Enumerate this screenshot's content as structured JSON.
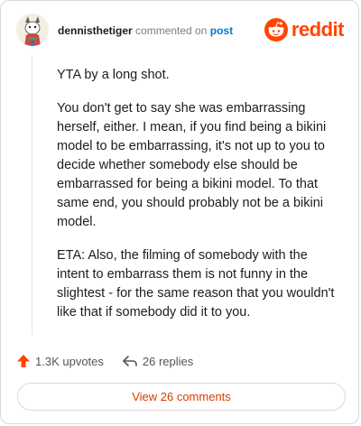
{
  "comment": {
    "username": "dennisthetiger",
    "action_text": "commented on",
    "post_link": "post",
    "paragraphs": [
      "YTA by a long shot.",
      "You don't get to say she was embarrassing herself, either. I mean, if you find being a bikini model to be embarrassing, it's not up to you to decide whether somebody else should be embarrassed for being a bikini model. To that same end, you should probably not be a bikini model.",
      "ETA: Also, the filming of somebody with the intent to embarrass them is not funny in the slightest - for the same reason that you wouldn't like that if somebody did it to you."
    ]
  },
  "brand": {
    "name": "reddit",
    "color": "#ff4500"
  },
  "stats": {
    "upvotes": "1.3K upvotes",
    "replies": "26 replies",
    "upvote_icon": "upvote-arrow-icon",
    "reply_icon": "reply-arrow-icon"
  },
  "actions": {
    "view_comments": "View 26 comments"
  },
  "colors": {
    "accent": "#ff4500",
    "link": "#0079d3",
    "button_text": "#d93a00"
  }
}
